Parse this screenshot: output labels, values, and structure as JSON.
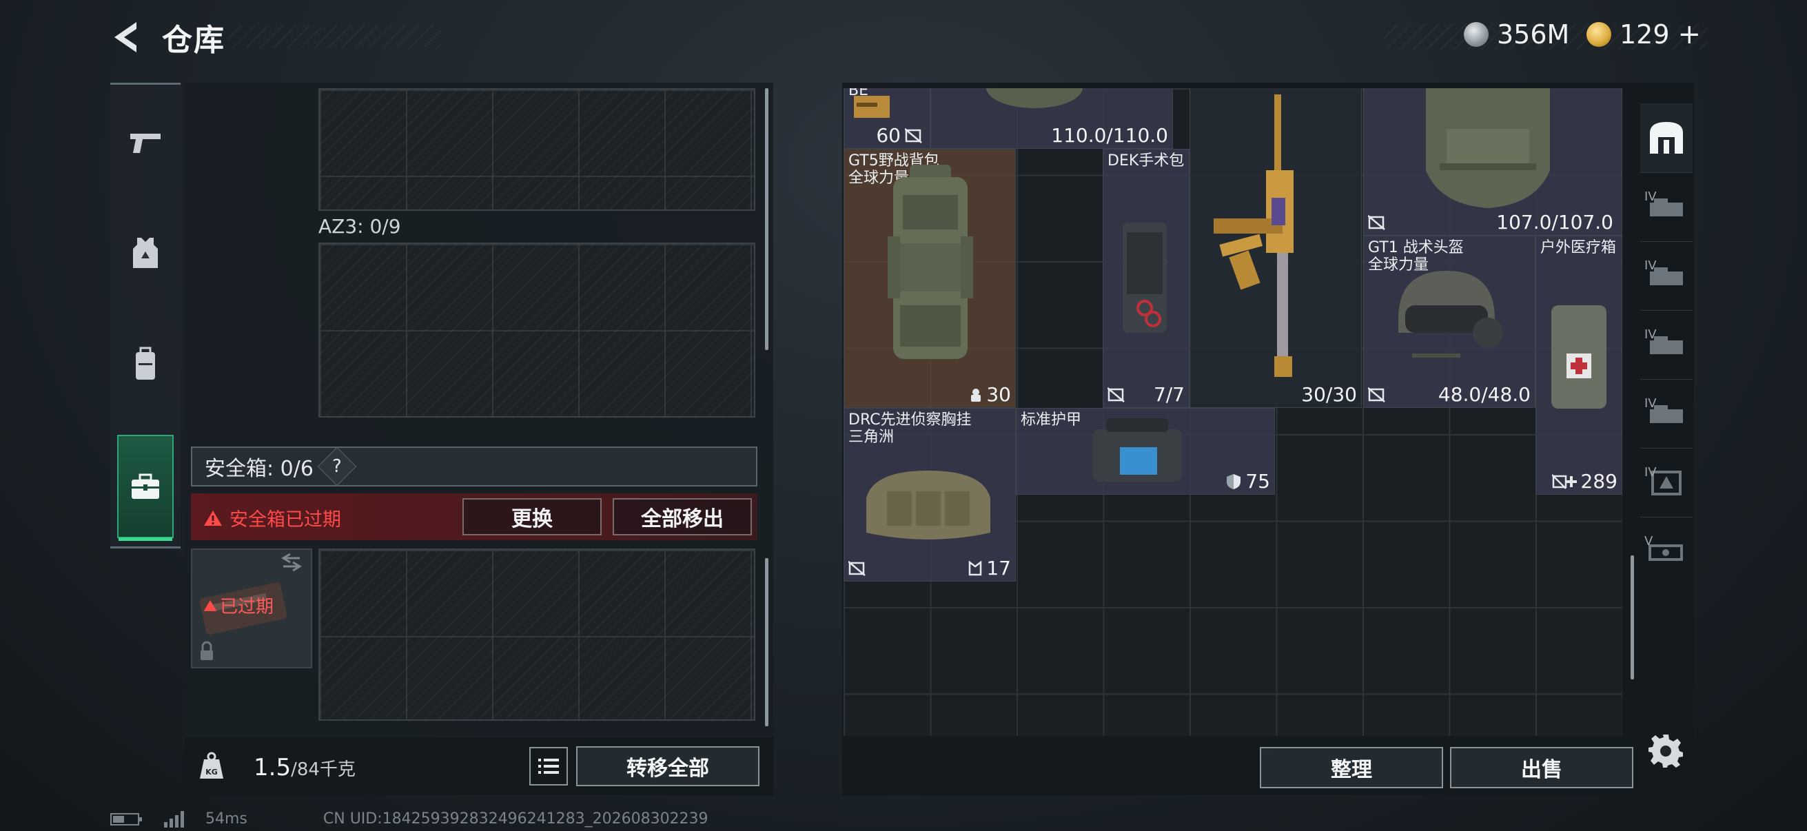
{
  "header": {
    "title": "仓库",
    "currency_silver": "356M",
    "currency_gold": "129",
    "currency_gold_plus": "+"
  },
  "left_nav": {
    "items": [
      "weapon-icon",
      "armor-vest-icon",
      "backpack-icon",
      "safebox-icon"
    ],
    "active_index": 3
  },
  "left_panel": {
    "az3_label": "AZ3: 0/9",
    "safe_box_label": "安全箱: 0/6",
    "safe_box_help": "?",
    "expired_warning": "安全箱已过期",
    "replace_button": "更换",
    "move_out_all_button": "全部移出",
    "slot_expired_badge": "已过期",
    "weight_value": "1.5",
    "weight_unit": "/84千克",
    "transfer_all_button": "转移全部"
  },
  "stash_items": [
    {
      "id": "ammo",
      "name": "BE",
      "value": "60"
    },
    {
      "id": "top-armor",
      "value": "110.0/110.0"
    },
    {
      "id": "gt5-backpack",
      "name": "GT5野战背包",
      "sub": "全球力量",
      "value": "30"
    },
    {
      "id": "dek-kit",
      "name": "DEK手术包",
      "value": "7/7"
    },
    {
      "id": "gold-rifle",
      "value": "30/30"
    },
    {
      "id": "plate-carrier",
      "value": "107.0/107.0"
    },
    {
      "id": "gt1-helmet",
      "name": "GT1 战术头盔",
      "sub": "全球力量",
      "value": "48.0/48.0"
    },
    {
      "id": "outdoor-medkit",
      "name": "户外医疗箱",
      "value": "289"
    },
    {
      "id": "drc-rig",
      "name": "DRC先进侦察胸挂",
      "sub": "三角洲",
      "value": "17"
    },
    {
      "id": "std-armor",
      "name": "标准护甲",
      "value": "75"
    }
  ],
  "right_panel": {
    "sort_button": "整理",
    "sell_button": "出售",
    "side_levels": [
      "IV",
      "IV",
      "IV",
      "IV",
      "IV",
      "V"
    ]
  },
  "status": {
    "ping": "54ms",
    "uid": "CN UID:184259392832496241283_202608302239"
  },
  "colors": {
    "accent_green": "#38d88d",
    "warning_red": "#ff4a4a",
    "gold": "#d9a93a"
  }
}
